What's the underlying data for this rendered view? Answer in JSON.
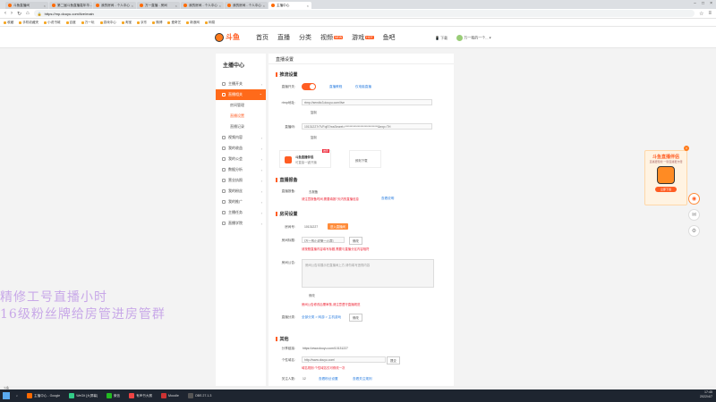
{
  "browser": {
    "tabs": [
      "斗鱼直播间",
      "第二届斗鱼直播嘉年华...",
      "我的房间 - 个人中心",
      "万一直播 - 房间",
      "我的房间 - 个人中心",
      "我的房间 - 个人中心",
      "主播中心"
    ],
    "active_tab": 6,
    "url": "https://mp.douyu.com/live/main",
    "bookmarks": [
      "收藏",
      "手机收藏夹",
      "小说书城",
      "百度",
      "万一玩",
      "游戏中心",
      "淘宝",
      "京东",
      "微博",
      "爱奇艺",
      "新浪网",
      "网易"
    ]
  },
  "site": {
    "logo_text": "斗鱼",
    "nav": [
      {
        "label": "首页"
      },
      {
        "label": "直播"
      },
      {
        "label": "分类"
      },
      {
        "label": "视频",
        "badge": "NEW"
      },
      {
        "label": "游戏",
        "badge": "HOT"
      },
      {
        "label": "鱼吧"
      }
    ],
    "header_right": {
      "download": "下载",
      "user": "万一我的一个..."
    }
  },
  "sidebar": {
    "title": "主播中心",
    "items": [
      {
        "label": "主播开关",
        "active": false
      },
      {
        "label": "直播相关",
        "active": true
      },
      {
        "label": "房间管理",
        "sub": true
      },
      {
        "label": "直播设置",
        "sub": true,
        "on": true
      },
      {
        "label": "直播记录",
        "sub": true
      },
      {
        "label": "视频内容",
        "active": false
      },
      {
        "label": "我的收益",
        "active": false
      },
      {
        "label": "我的公会",
        "active": false
      },
      {
        "label": "数据分析",
        "active": false
      },
      {
        "label": "营业执照",
        "active": false
      },
      {
        "label": "我的粉丝",
        "active": false
      },
      {
        "label": "我的推广",
        "active": false
      },
      {
        "label": "主播任务",
        "active": false
      },
      {
        "label": "直播学院",
        "active": false
      }
    ]
  },
  "content": {
    "crumb": "直播设置",
    "stream": {
      "title": "推流设置",
      "switch_label": "直播开关:",
      "switch_link1": "直播教程",
      "switch_link2": "仅电脑直播",
      "rtmp_label": "rtmp地址:",
      "rtmp_value": "rtmp://sendtc3.douyu.com/live",
      "copy1": "复制",
      "code_label": "直播码:",
      "code_value": "10131227rTVFqiS?wsSecret=****************************&exp=TH",
      "copy2": "复制",
      "app_name": "斗鱼直播伴侣",
      "app_sub": "可直接一键开播",
      "app_hot": "推荐",
      "app_download": "即刻下载"
    },
    "report": {
      "title": "直播报备",
      "label": "直播报备:",
      "value": "去报备",
      "warn": "请注意报备时间,需要填报7天内的直播信息",
      "link": "查看说明"
    },
    "room": {
      "title": "房间设置",
      "id_label": "房间号:",
      "id_value": "10131227",
      "enter_btn": "进入直播间",
      "name_label": "房间标题:",
      "name_value": "[万一的小说第一六章]",
      "name_edit": "修改",
      "name_warn": "请按照直播内容填写标题,需要与直播分区内容相符",
      "notice_label": "房间公告:",
      "notice_placeholder": "房间公告将展示在直播间上方,请勿填写违规内容",
      "notice_edit": "修改",
      "notice_warn": "房间公告修改后需审核,请注意遵守直播规范",
      "cat_label": "直播分类:",
      "cat_value": "全部分类 > 网游 > 主机游戏",
      "cat_edit": "修改"
    },
    "other": {
      "title": "其他",
      "share_label": "分享链接:",
      "share_value": "https://www.douyu.com/10131227",
      "domain_label": "个性域名:",
      "domain_prefix": "http://www.douyu.com/",
      "domain_btn": "提交",
      "domain_warn": "域名规则:个性域名仅可修改一次",
      "follow_label": "关注人数:",
      "follow_value": "12",
      "follow_link1": "查看粉丝设置",
      "follow_link2": "查看关注规则"
    }
  },
  "ad": {
    "title": "斗鱼直播伴侣",
    "sub": "直播更轻松 一键直播更方便",
    "button": "立即下载",
    "close": "×"
  },
  "watermark": [
    "精修工号直播小时",
    "16级粉丝牌给房管进房管群"
  ],
  "status": "斗鱼",
  "taskbar": {
    "items": [
      "主播中心 - Google",
      "WeGit [大屏幕]",
      "微信",
      "有声书大赛",
      "Moodle",
      "OBS 27.1.3"
    ],
    "clock_time": "17:45",
    "clock_date": "2022/4/7"
  },
  "colors": {
    "accent": "#ff5d23",
    "link": "#2d7fe0",
    "warn": "#ee2233"
  }
}
